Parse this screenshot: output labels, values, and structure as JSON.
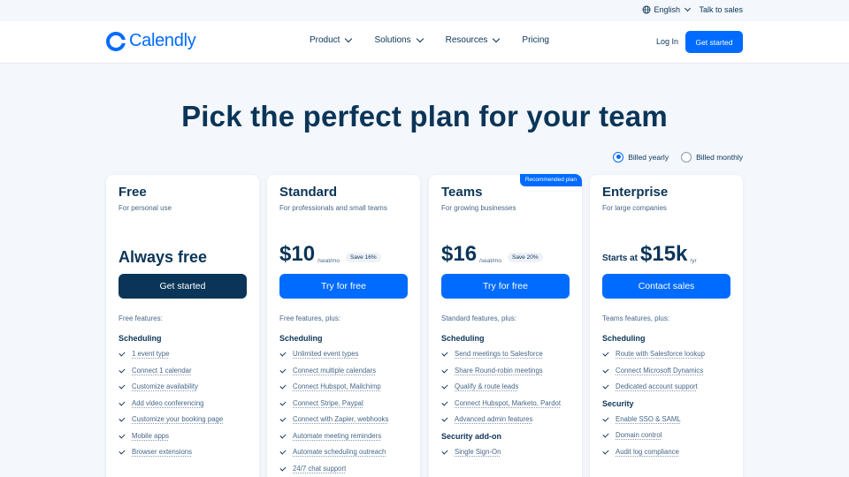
{
  "topbar": {
    "language": "English",
    "talk": "Talk to sales"
  },
  "nav": {
    "brand": "Calendly",
    "menu": [
      "Product",
      "Solutions",
      "Resources",
      "Pricing"
    ],
    "login": "Log In",
    "cta": "Get started"
  },
  "hero": {
    "title": "Pick the perfect plan for your team"
  },
  "billing": {
    "yearly": "Billed yearly",
    "monthly": "Billed monthly",
    "selected": "yearly"
  },
  "plans": [
    {
      "name": "Free",
      "desc": "For personal use",
      "price_text": "Always free",
      "button": "Get started",
      "features_head": "Free features:",
      "sections": [
        {
          "title": "Scheduling",
          "items": [
            "1 event type",
            "Connect 1 calendar",
            "Customize availability",
            "Add video conferencing",
            "Customize your booking page",
            "Mobile apps",
            "Browser extensions"
          ]
        }
      ]
    },
    {
      "name": "Standard",
      "desc": "For professionals and small teams",
      "price": "$10",
      "unit": "/seat/mo",
      "save": "Save 16%",
      "button": "Try for free",
      "features_head": "Free features, plus:",
      "sections": [
        {
          "title": "Scheduling",
          "items": [
            "Unlimited event types",
            "Connect multiple calendars",
            "Connect Hubspot, Mailchimp",
            "Connect Stripe, Paypal",
            "Connect with Zapier, webhooks",
            "Automate meeting reminders",
            "Automate scheduling outreach",
            "24/7 chat support"
          ]
        }
      ]
    },
    {
      "name": "Teams",
      "desc": "For growing businesses",
      "ribbon": "Recommended plan",
      "price": "$16",
      "unit": "/seat/mo",
      "save": "Save 20%",
      "button": "Try for free",
      "features_head": "Standard features, plus:",
      "sections": [
        {
          "title": "Scheduling",
          "items": [
            "Send meetings to Salesforce",
            "Share Round-robin meetings",
            "Qualify & route leads",
            "Connect Hubspot, Marketo, Pardot",
            "Advanced admin features"
          ]
        },
        {
          "title": "Security add-on",
          "items": [
            "Single Sign-On"
          ]
        }
      ]
    },
    {
      "name": "Enterprise",
      "desc": "For large companies",
      "starts": "Starts at",
      "price": "$15k",
      "unit": "/yr",
      "button": "Contact sales",
      "features_head": "Teams features, plus:",
      "sections": [
        {
          "title": "Scheduling",
          "items": [
            "Route with Salesforce lookup",
            "Connect Microsoft Dynamics",
            "Dedicated account support"
          ]
        },
        {
          "title": "Security",
          "items": [
            "Enable SSO & SAML",
            "Domain control",
            "Audit log compliance"
          ]
        }
      ]
    }
  ]
}
